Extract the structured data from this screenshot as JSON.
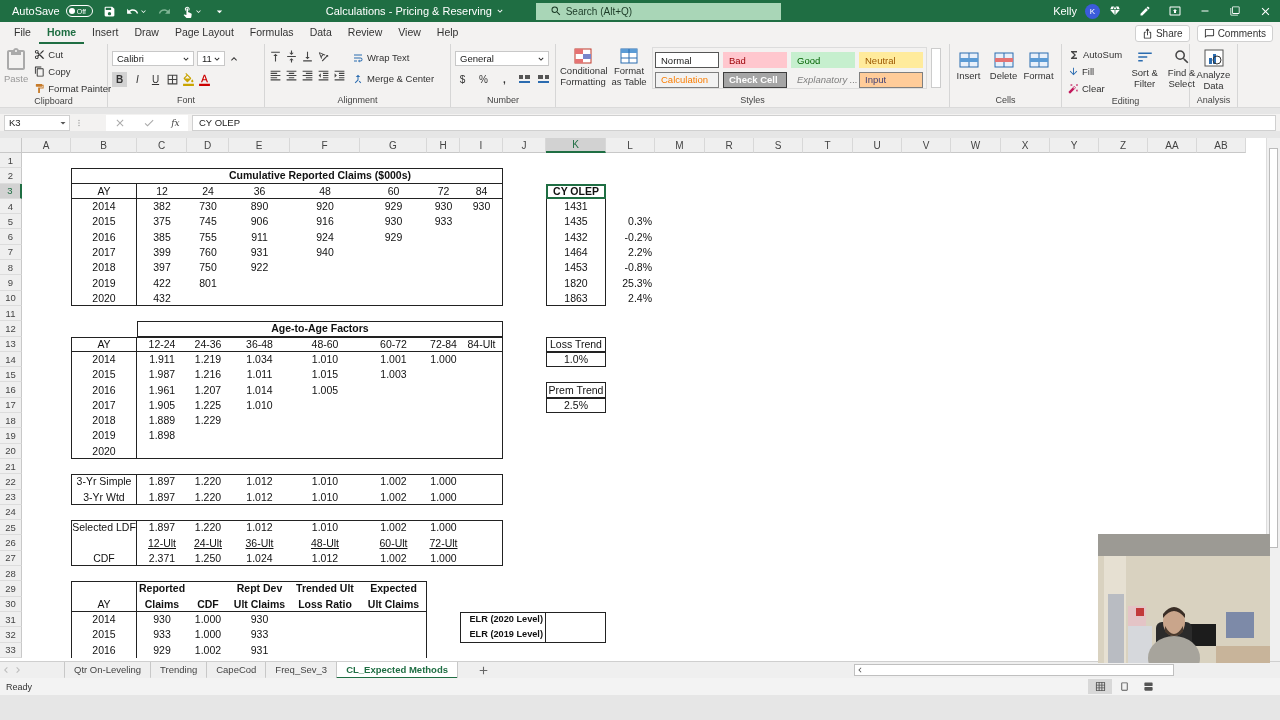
{
  "title_bar": {
    "autosave": "AutoSave",
    "autosave_toggle": {
      "label": "Off",
      "on": false
    },
    "title": "Calculations - Pricing & Reserving",
    "search": {
      "placeholder": "Search (Alt+Q)"
    },
    "user": "Kelly",
    "avatar": "K"
  },
  "menu_tabs": [
    {
      "label": "File",
      "selected": false
    },
    {
      "label": "Home",
      "selected": true
    },
    {
      "label": "Insert",
      "selected": false
    },
    {
      "label": "Draw",
      "selected": false
    },
    {
      "label": "Page Layout",
      "selected": false
    },
    {
      "label": "Formulas",
      "selected": false
    },
    {
      "label": "Data",
      "selected": false
    },
    {
      "label": "Review",
      "selected": false
    },
    {
      "label": "View",
      "selected": false
    },
    {
      "label": "Help",
      "selected": false
    }
  ],
  "share": "Share",
  "comments": "Comments",
  "ribbon": [
    {
      "kind": "clipboard",
      "label": "Clipboard",
      "paste": "Paste",
      "cut": "Cut",
      "copy": "Copy",
      "format_painter": "Format Painter"
    },
    {
      "kind": "font",
      "label": "Font",
      "font": "Calibri",
      "size": "11",
      "bold": "B",
      "italic": "I",
      "underline": "U"
    },
    {
      "kind": "alignment",
      "label": "Alignment",
      "wrap": "Wrap Text",
      "merge": "Merge & Center"
    },
    {
      "kind": "number",
      "label": "Number",
      "format": "General",
      "currency": "$",
      "percent": "%",
      "comma": ","
    },
    {
      "kind": "styles",
      "label": "Styles",
      "conditional": "Conditional Formatting",
      "table": "Format as Table",
      "styles": [
        {
          "label": "Normal",
          "color": "#ffffff"
        },
        {
          "label": "Bad",
          "color": "#ffc7ce"
        },
        {
          "label": "Good",
          "color": "#c6efce"
        },
        {
          "label": "Neutral",
          "color": "#ffeb9c"
        },
        {
          "label": "Calculation",
          "color": "#f2f2f2"
        },
        {
          "label": "Check Cell",
          "color": "#a5a5a5"
        },
        {
          "label": "Explanatory ...",
          "color": "#f3f2f1"
        },
        {
          "label": "Input",
          "color": "#ffcc99"
        }
      ]
    },
    {
      "kind": "cells",
      "label": "Cells",
      "buttons": [
        "Insert",
        "Delete",
        "Format"
      ]
    },
    {
      "kind": "editing",
      "label": "Editing",
      "autosum": "AutoSum",
      "fill": "Fill",
      "clear": "Clear",
      "sort": "Sort & Filter",
      "find": "Find & Select"
    },
    {
      "kind": "analysis",
      "label": "Analysis",
      "button": "Analyze Data"
    }
  ],
  "formula_bar": {
    "name_box": "K3",
    "function_label": "fx",
    "formula": "CY OLEP"
  },
  "column_headers": [
    {
      "label": "A",
      "selected": false
    },
    {
      "label": "B",
      "selected": false
    },
    {
      "label": "C",
      "selected": false
    },
    {
      "label": "D",
      "selected": false
    },
    {
      "label": "E",
      "selected": false
    },
    {
      "label": "F",
      "selected": false
    },
    {
      "label": "G",
      "selected": false
    },
    {
      "label": "H",
      "selected": false
    },
    {
      "label": "I",
      "selected": false
    },
    {
      "label": "J",
      "selected": false
    },
    {
      "label": "K",
      "selected": true
    },
    {
      "label": "L",
      "selected": false
    },
    {
      "label": "M",
      "selected": false
    },
    {
      "label": "R",
      "selected": false
    },
    {
      "label": "S",
      "selected": false
    },
    {
      "label": "T",
      "selected": false
    },
    {
      "label": "U",
      "selected": false
    },
    {
      "label": "V",
      "selected": false
    },
    {
      "label": "W",
      "selected": false
    },
    {
      "label": "X",
      "selected": false
    },
    {
      "label": "Y",
      "selected": false
    },
    {
      "label": "Z",
      "selected": false
    },
    {
      "label": "AA",
      "selected": false
    },
    {
      "label": "AB",
      "selected": false
    }
  ],
  "row_headers": [
    {
      "label": "1",
      "selected": false
    },
    {
      "label": "2",
      "selected": false
    },
    {
      "label": "3",
      "selected": true
    },
    {
      "label": "4",
      "selected": false
    },
    {
      "label": "5",
      "selected": false
    },
    {
      "label": "6",
      "selected": false
    },
    {
      "label": "7",
      "selected": false
    },
    {
      "label": "8",
      "selected": false
    },
    {
      "label": "9",
      "selected": false
    },
    {
      "label": "10",
      "selected": false
    },
    {
      "label": "11",
      "selected": false
    },
    {
      "label": "12",
      "selected": false
    },
    {
      "label": "13",
      "selected": false
    },
    {
      "label": "14",
      "selected": false
    },
    {
      "label": "15",
      "selected": false
    },
    {
      "label": "16",
      "selected": false
    },
    {
      "label": "17",
      "selected": false
    },
    {
      "label": "18",
      "selected": false
    },
    {
      "label": "19",
      "selected": false
    },
    {
      "label": "20",
      "selected": false
    },
    {
      "label": "21",
      "selected": false
    },
    {
      "label": "22",
      "selected": false
    },
    {
      "label": "23",
      "selected": false
    },
    {
      "label": "24",
      "selected": false
    },
    {
      "label": "25",
      "selected": false
    },
    {
      "label": "26",
      "selected": false
    },
    {
      "label": "27",
      "selected": false
    },
    {
      "label": "28",
      "selected": false
    },
    {
      "label": "29",
      "selected": false
    },
    {
      "label": "30",
      "selected": false
    },
    {
      "label": "31",
      "selected": false
    },
    {
      "label": "32",
      "selected": false
    },
    {
      "label": "33",
      "selected": false
    }
  ],
  "claims_table": {
    "title": "Cumulative Reported Claims ($000s)",
    "columns": [
      "AY",
      "12",
      "24",
      "36",
      "48",
      "60",
      "72",
      "84"
    ],
    "rows": [
      {
        "label": "2014",
        "values": [
          "382",
          "730",
          "890",
          "920",
          "929",
          "930",
          "930"
        ]
      },
      {
        "label": "2015",
        "values": [
          "375",
          "745",
          "906",
          "916",
          "930",
          "933"
        ]
      },
      {
        "label": "2016",
        "values": [
          "385",
          "755",
          "911",
          "924",
          "929"
        ]
      },
      {
        "label": "2017",
        "values": [
          "399",
          "760",
          "931",
          "940"
        ]
      },
      {
        "label": "2018",
        "values": [
          "397",
          "750",
          "922"
        ]
      },
      {
        "label": "2019",
        "values": [
          "422",
          "801"
        ]
      },
      {
        "label": "2020",
        "values": [
          "432"
        ]
      }
    ]
  },
  "cy_olep": {
    "header": "CY OLEP",
    "selected": true,
    "values": [
      "1431",
      "1435",
      "1432",
      "1464",
      "1453",
      "1820",
      "1863"
    ],
    "changes": [
      "0.3%",
      "-0.2%",
      "2.2%",
      "-0.8%",
      "25.3%",
      "2.4%"
    ]
  },
  "factors_table": {
    "title": "Age-to-Age Factors",
    "columns": [
      "AY",
      "12-24",
      "24-36",
      "36-48",
      "48-60",
      "60-72",
      "72-84",
      "84-Ult"
    ],
    "rows": [
      {
        "label": "2014",
        "values": [
          "1.911",
          "1.219",
          "1.034",
          "1.010",
          "1.001",
          "1.000"
        ]
      },
      {
        "label": "2015",
        "values": [
          "1.987",
          "1.216",
          "1.011",
          "1.015",
          "1.003"
        ]
      },
      {
        "label": "2016",
        "values": [
          "1.961",
          "1.207",
          "1.014",
          "1.005"
        ]
      },
      {
        "label": "2017",
        "values": [
          "1.905",
          "1.225",
          "1.010"
        ]
      },
      {
        "label": "2018",
        "values": [
          "1.889",
          "1.229"
        ]
      },
      {
        "label": "2019",
        "values": [
          "1.898"
        ]
      },
      {
        "label": "2020",
        "values": []
      }
    ]
  },
  "averages": [
    {
      "label": "3-Yr Simple",
      "values": [
        "1.897",
        "1.220",
        "1.012",
        "1.010",
        "1.002",
        "1.000"
      ]
    },
    {
      "label": "3-Yr Wtd",
      "values": [
        "1.897",
        "1.220",
        "1.012",
        "1.010",
        "1.002",
        "1.000"
      ]
    }
  ],
  "selected_factors": [
    {
      "kind": "factor",
      "label": "Selected LDF",
      "values": [
        "1.897",
        "1.220",
        "1.012",
        "1.010",
        "1.002",
        "1.000"
      ]
    },
    {
      "kind": "ages",
      "values": [
        "12-Ult",
        "24-Ult",
        "36-Ult",
        "48-Ult",
        "60-Ult",
        "72-Ult"
      ]
    },
    {
      "kind": "factor",
      "label": "CDF",
      "values": [
        "2.371",
        "1.250",
        "1.024",
        "1.012",
        "1.002",
        "1.000"
      ]
    }
  ],
  "trends": [
    {
      "label": "Loss Trend",
      "value": "1.0%"
    },
    {
      "label": "Prem Trend",
      "value": "2.5%"
    }
  ],
  "expected_table": {
    "columns": [
      {
        "bottom": "AY"
      },
      {
        "top": "Reported",
        "bottom": "Claims"
      },
      {
        "bottom": "CDF"
      },
      {
        "top": "Rept Dev",
        "bottom": "Ult Claims"
      },
      {
        "top": "Trended Ult",
        "bottom": "Loss Ratio"
      },
      {
        "top": "Expected",
        "bottom": "Ult Claims"
      }
    ],
    "rows": [
      {
        "label": "2014",
        "values": [
          "930",
          "1.000",
          "930"
        ]
      },
      {
        "label": "2015",
        "values": [
          "933",
          "1.000",
          "933"
        ]
      },
      {
        "label": "2016",
        "values": [
          "929",
          "1.002",
          "931"
        ]
      }
    ]
  },
  "elr": [
    "ELR (2020 Level)",
    "ELR (2019 Level)"
  ],
  "sheet_tabs": [
    {
      "label": "Qtr On-Leveling",
      "selected": false
    },
    {
      "label": "Trending",
      "selected": false
    },
    {
      "label": "CapeCod",
      "selected": false
    },
    {
      "label": "Freq_Sev_3",
      "selected": false
    },
    {
      "label": "CL_Expected Methods",
      "selected": true
    }
  ],
  "status": "Ready",
  "webcam": {
    "kind": "picture"
  }
}
